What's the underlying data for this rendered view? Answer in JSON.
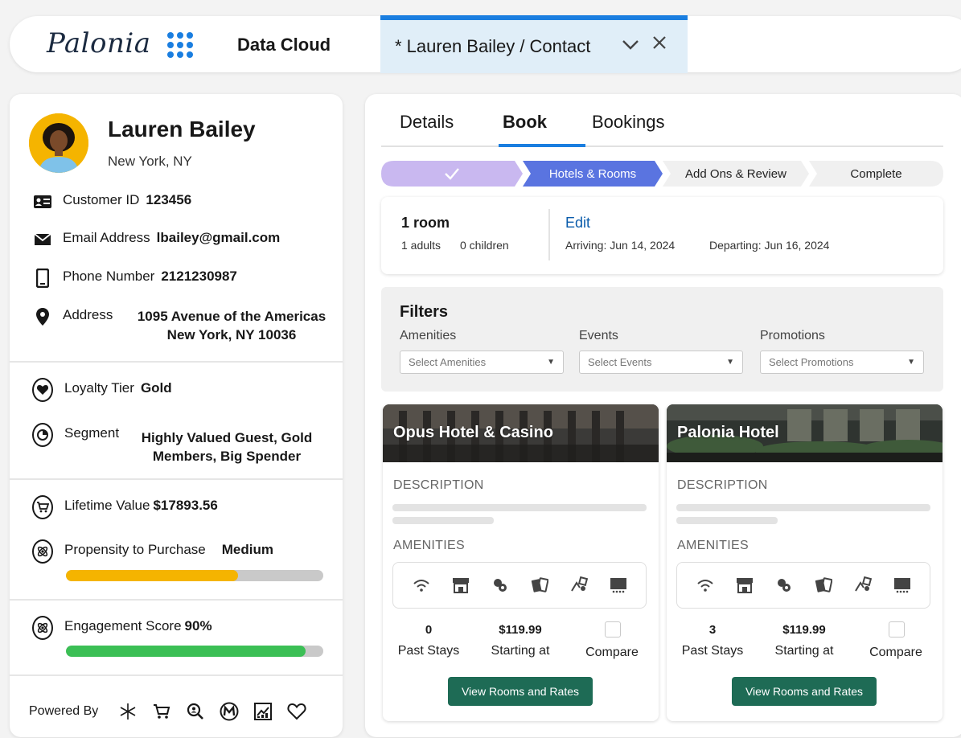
{
  "app": {
    "logo": "Palonia",
    "app_name": "Data Cloud",
    "tab_label": "* Lauren Bailey / Contact"
  },
  "profile": {
    "name": "Lauren Bailey",
    "city": "New York, NY",
    "customer_id_label": "Customer ID",
    "customer_id": "123456",
    "email_label": "Email Address",
    "email": "lbailey@gmail.com",
    "phone_label": "Phone Number",
    "phone": "2121230987",
    "address_label": "Address",
    "address_line1": "1095 Avenue of the Americas",
    "address_line2": "New York, NY 10036",
    "loyalty_label": "Loyalty Tier",
    "loyalty": "Gold",
    "segment_label": "Segment",
    "segment_line1": "Highly Valued Guest, Gold",
    "segment_line2": "Members, Big Spender",
    "lifetime_label": "Lifetime Value",
    "lifetime": "$17893.56",
    "propensity_label": "Propensity to Purchase",
    "propensity": "Medium",
    "propensity_fraction": 0.67,
    "engagement_label": "Engagement Score",
    "engagement": "90%",
    "engagement_fraction": 0.93,
    "powered_by": "Powered By"
  },
  "tabs": [
    "Details",
    "Book",
    "Bookings"
  ],
  "path": {
    "steps": [
      "Hotels & Rooms",
      "Add Ons & Review",
      "Complete"
    ]
  },
  "room": {
    "title": "1 room",
    "adults": "1 adults",
    "children": "0 children",
    "edit": "Edit",
    "arriving": "Arriving: Jun 14, 2024",
    "departing": "Departing: Jun 16, 2024"
  },
  "filters": {
    "title": "Filters",
    "amenities_label": "Amenities",
    "amenities_placeholder": "Select Amenities",
    "events_label": "Events",
    "events_placeholder": "Select Events",
    "promotions_label": "Promotions",
    "promotions_placeholder": "Select Promotions"
  },
  "hotel_labels": {
    "description": "DESCRIPTION",
    "amenities": "AMENITIES",
    "past_stays": "Past Stays",
    "starting_at": "Starting at",
    "compare": "Compare",
    "view_button": "View Rooms and Rates"
  },
  "hotels": [
    {
      "name": "Opus Hotel & Casino",
      "past_stays": "0",
      "price": "$119.99"
    },
    {
      "name": "Palonia Hotel",
      "past_stays": "3",
      "price": "$119.99"
    }
  ],
  "colors": {
    "brand_blue": "#1a7ee0",
    "path_complete": "#c9b8f0",
    "path_current": "#5a74e0",
    "propensity_bar": "#f5b400",
    "engagement_bar": "#3bbf55",
    "button_green": "#1e6b55"
  }
}
